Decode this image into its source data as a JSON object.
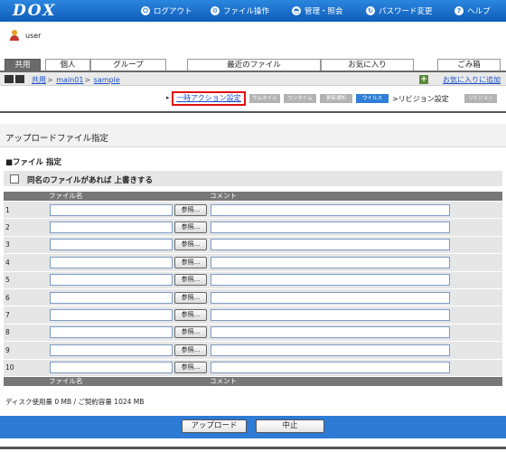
{
  "header": {
    "logo": "DOX",
    "nav": [
      {
        "icon": "logout-icon",
        "glyph": "⏻",
        "label": "ログアウト"
      },
      {
        "icon": "file-operation-icon",
        "glyph": "⚙",
        "label": "ファイル操作"
      },
      {
        "icon": "admin-icon",
        "glyph": "◓",
        "label": "管理・照会"
      },
      {
        "icon": "password-icon",
        "glyph": "↻",
        "label": "パスワード変更"
      },
      {
        "icon": "help-icon",
        "glyph": "?",
        "label": "ヘルプ"
      }
    ]
  },
  "user": {
    "name": "user"
  },
  "tabs": {
    "shared": "共用",
    "personal": "個人",
    "group": "グループ",
    "recent": "最近のファイル",
    "favorites": "お気に入り",
    "trash": "ごみ箱"
  },
  "breadcrumb": {
    "items": [
      "共用",
      "main01",
      "sample"
    ],
    "separator": ">",
    "add_favorite": "お気に入りに追加"
  },
  "actions": {
    "temp_action": "一時アクション設定",
    "thumbnail": "サムネイル",
    "one_time": "ワンタイム",
    "update_notice": "更新通知",
    "virus": "ウイルス",
    "revision_label": ">リビジョン設定",
    "revision": "リビジョン"
  },
  "page": {
    "title": "アップロードファイル指定",
    "section": "■ファイル 指定",
    "overwrite_label": "同名のファイルがあれば 上書きする"
  },
  "table": {
    "col_name": "ファイル名",
    "col_comment": "コメント",
    "browse_label": "参照...",
    "rows": [
      "1",
      "2",
      "3",
      "4",
      "5",
      "6",
      "7",
      "8",
      "9",
      "10"
    ]
  },
  "disk_usage": "ディスク使用量 0 MB / ご契約容量 1024 MB",
  "buttons": {
    "upload": "アップロード",
    "cancel": "中止"
  }
}
